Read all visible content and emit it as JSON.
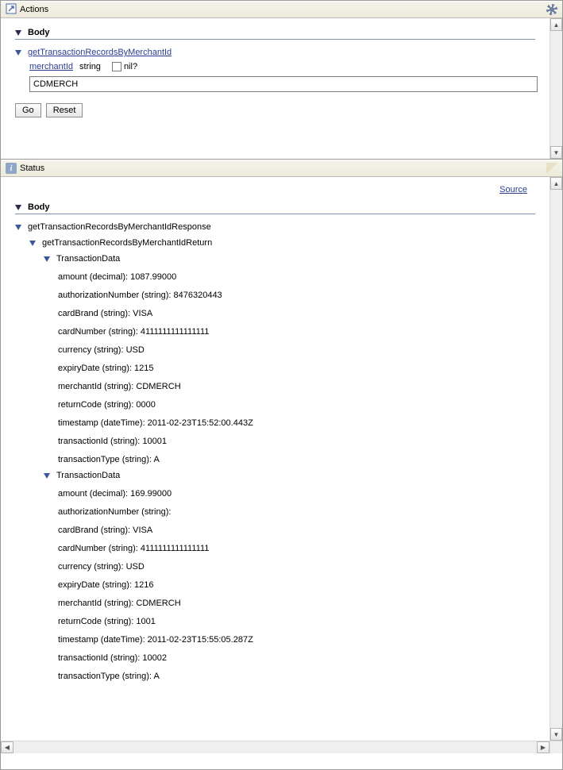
{
  "actions": {
    "title": "Actions",
    "body_label": "Body",
    "operation": "getTransactionRecordsByMerchantId",
    "param_name": "merchantId",
    "param_type": "string",
    "nil_label": "nil?",
    "input_value": "CDMERCH",
    "go_label": "Go",
    "reset_label": "Reset"
  },
  "status": {
    "title": "Status",
    "source_label": "Source",
    "body_label": "Body",
    "root": "getTransactionRecordsByMerchantIdResponse",
    "return_node": "getTransactionRecordsByMerchantIdReturn",
    "record_label": "TransactionData",
    "records": [
      {
        "fields": [
          {
            "name": "amount",
            "type": "decimal",
            "value": "1087.99000"
          },
          {
            "name": "authorizationNumber",
            "type": "string",
            "value": "8476320443"
          },
          {
            "name": "cardBrand",
            "type": "string",
            "value": "VISA"
          },
          {
            "name": "cardNumber",
            "type": "string",
            "value": "4111111111111111"
          },
          {
            "name": "currency",
            "type": "string",
            "value": "USD"
          },
          {
            "name": "expiryDate",
            "type": "string",
            "value": "1215"
          },
          {
            "name": "merchantId",
            "type": "string",
            "value": "CDMERCH"
          },
          {
            "name": "returnCode",
            "type": "string",
            "value": "0000"
          },
          {
            "name": "timestamp",
            "type": "dateTime",
            "value": "2011-02-23T15:52:00.443Z"
          },
          {
            "name": "transactionId",
            "type": "string",
            "value": "10001"
          },
          {
            "name": "transactionType",
            "type": "string",
            "value": "A"
          }
        ]
      },
      {
        "fields": [
          {
            "name": "amount",
            "type": "decimal",
            "value": "169.99000"
          },
          {
            "name": "authorizationNumber",
            "type": "string",
            "value": ""
          },
          {
            "name": "cardBrand",
            "type": "string",
            "value": "VISA"
          },
          {
            "name": "cardNumber",
            "type": "string",
            "value": "4111111111111111"
          },
          {
            "name": "currency",
            "type": "string",
            "value": "USD"
          },
          {
            "name": "expiryDate",
            "type": "string",
            "value": "1216"
          },
          {
            "name": "merchantId",
            "type": "string",
            "value": "CDMERCH"
          },
          {
            "name": "returnCode",
            "type": "string",
            "value": "1001"
          },
          {
            "name": "timestamp",
            "type": "dateTime",
            "value": "2011-02-23T15:55:05.287Z"
          },
          {
            "name": "transactionId",
            "type": "string",
            "value": "10002"
          },
          {
            "name": "transactionType",
            "type": "string",
            "value": "A"
          }
        ]
      }
    ]
  }
}
